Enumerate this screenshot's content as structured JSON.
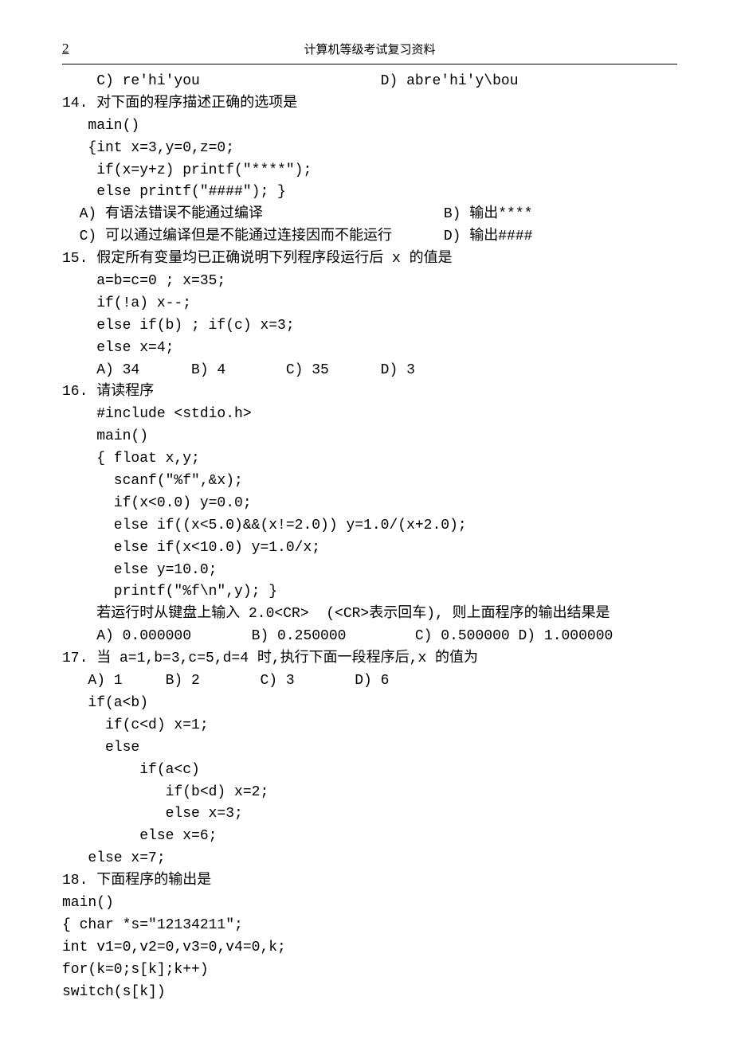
{
  "header": {
    "page_number": "2",
    "title": "计算机等级考试复习资料"
  },
  "lines": [
    "    C) re'hi'you                     D) abre'hi'y\\bou",
    "14. 对下面的程序描述正确的选项是",
    "   main()",
    "   {int x=3,y=0,z=0;",
    "    if(x=y+z) printf(\"****\");",
    "    else printf(\"####\"); }",
    "  A) 有语法错误不能通过编译                     B) 输出****",
    "  C) 可以通过编译但是不能通过连接因而不能运行      D) 输出####",
    "15. 假定所有变量均已正确说明下列程序段运行后 x 的值是",
    "    a=b=c=0 ; x=35;",
    "    if(!a) x--;",
    "    else if(b) ; if(c) x=3;",
    "    else x=4;",
    "    A) 34      B) 4       C) 35      D) 3",
    "16. 请读程序",
    "    #include <stdio.h>",
    "    main()",
    "    { float x,y;",
    "      scanf(\"%f\",&x);",
    "      if(x<0.0) y=0.0;",
    "      else if((x<5.0)&&(x!=2.0)) y=1.0/(x+2.0);",
    "      else if(x<10.0) y=1.0/x;",
    "      else y=10.0;",
    "      printf(\"%f\\n\",y); }",
    "    若运行时从键盘上输入 2.0<CR>  (<CR>表示回车), 则上面程序的输出结果是",
    "    A) 0.000000       B) 0.250000        C) 0.500000 D) 1.000000",
    "17. 当 a=1,b=3,c=5,d=4 时,执行下面一段程序后,x 的值为",
    "   A) 1     B) 2       C) 3       D) 6",
    "   if(a<b)",
    "     if(c<d) x=1;",
    "     else",
    "         if(a<c)",
    "            if(b<d) x=2;",
    "            else x=3;",
    "         else x=6;",
    "   else x=7;",
    "18. 下面程序的输出是",
    "main()",
    "{ char *s=\"12134211\";",
    "int v1=0,v2=0,v3=0,v4=0,k;",
    "for(k=0;s[k];k++)",
    "switch(s[k])"
  ]
}
